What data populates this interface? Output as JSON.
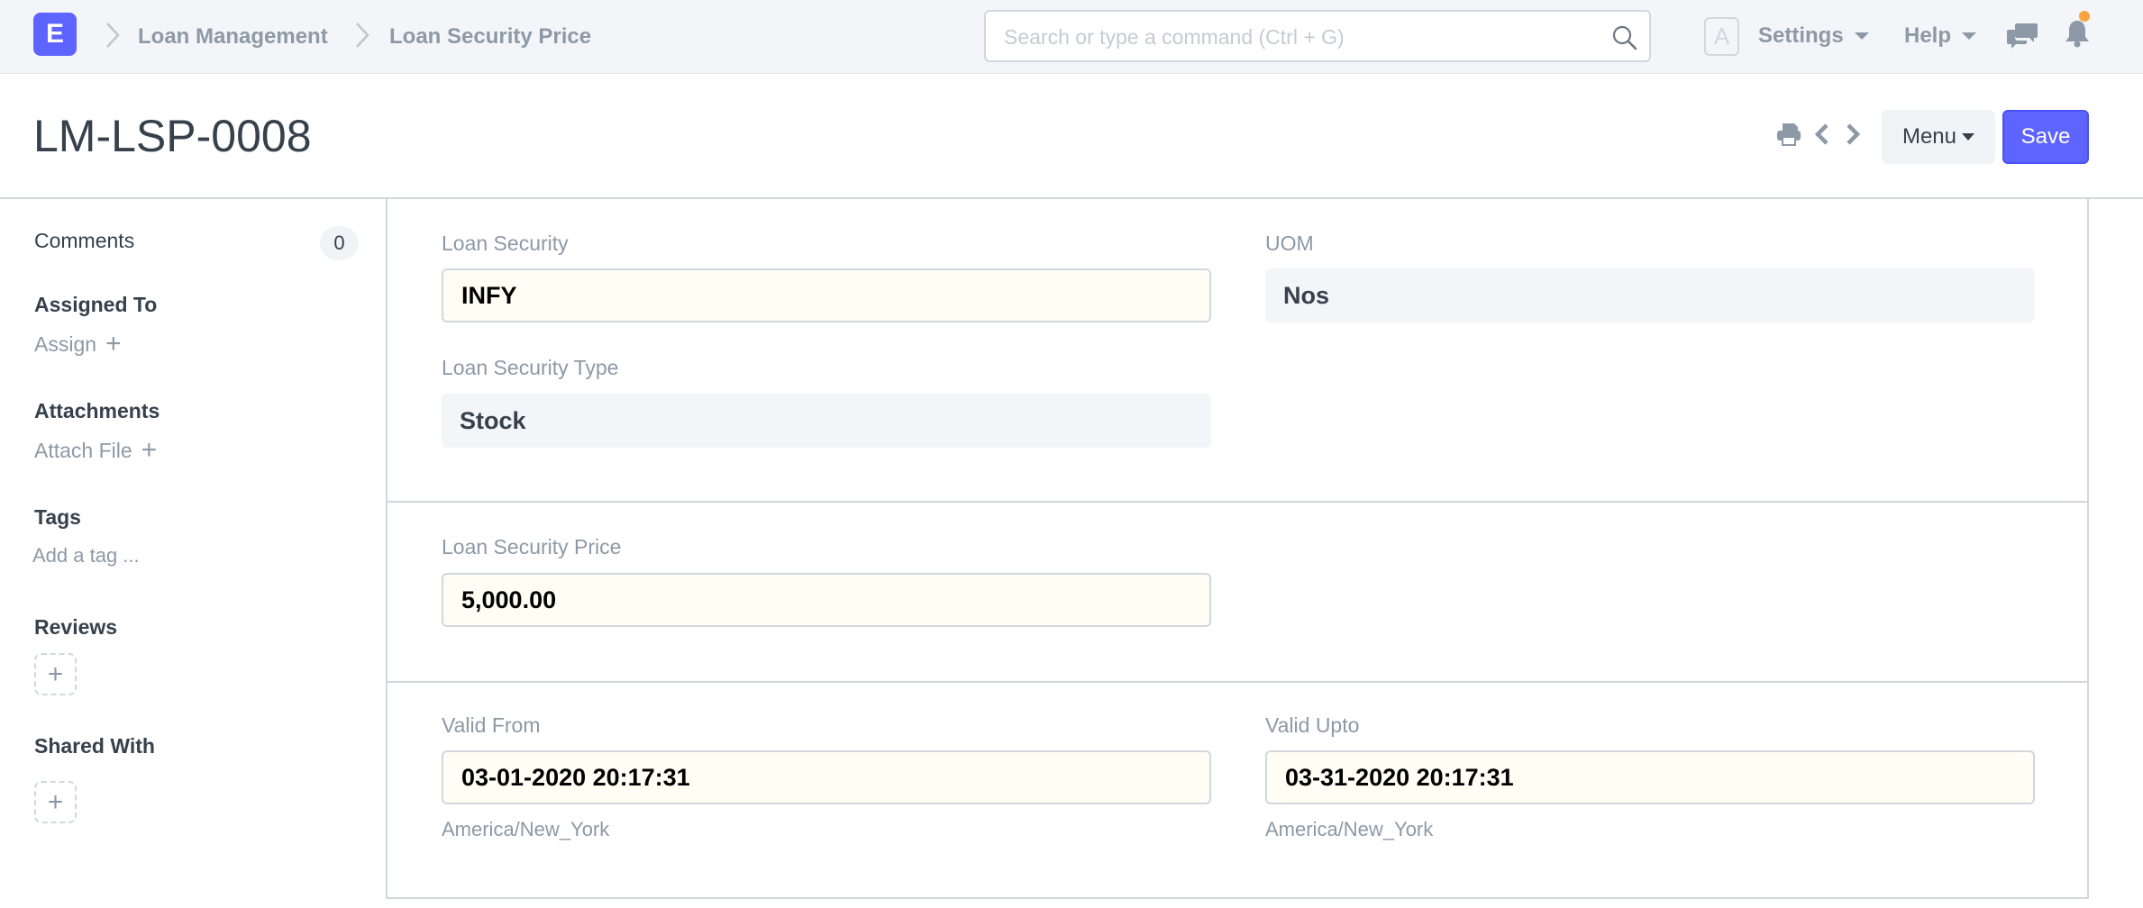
{
  "navbar": {
    "logo_letter": "E",
    "breadcrumbs": [
      "Loan Management",
      "Loan Security Price"
    ],
    "search_placeholder": "Search or type a command (Ctrl + G)",
    "avatar_letter": "A",
    "settings_label": "Settings",
    "help_label": "Help",
    "notification_dot_color": "#f8a440"
  },
  "page_head": {
    "title": "LM-LSP-0008",
    "menu_label": "Menu",
    "save_label": "Save",
    "accent_color": "#5e64ff"
  },
  "sidebar": {
    "comments_label": "Comments",
    "comments_count": "0",
    "assigned_to_label": "Assigned To",
    "assign_label": "Assign",
    "attachments_label": "Attachments",
    "attach_file_label": "Attach File",
    "tags_label": "Tags",
    "add_tag_label": "Add a tag ...",
    "reviews_label": "Reviews",
    "shared_with_label": "Shared With"
  },
  "form": {
    "loan_security": {
      "label": "Loan Security",
      "value": "INFY"
    },
    "uom": {
      "label": "UOM",
      "value": "Nos"
    },
    "loan_security_type": {
      "label": "Loan Security Type",
      "value": "Stock"
    },
    "loan_security_price": {
      "label": "Loan Security Price",
      "value": "5,000.00"
    },
    "valid_from": {
      "label": "Valid From",
      "value": "03-01-2020 20:17:31",
      "timezone": "America/New_York"
    },
    "valid_upto": {
      "label": "Valid Upto",
      "value": "03-31-2020 20:17:31",
      "timezone": "America/New_York"
    }
  }
}
